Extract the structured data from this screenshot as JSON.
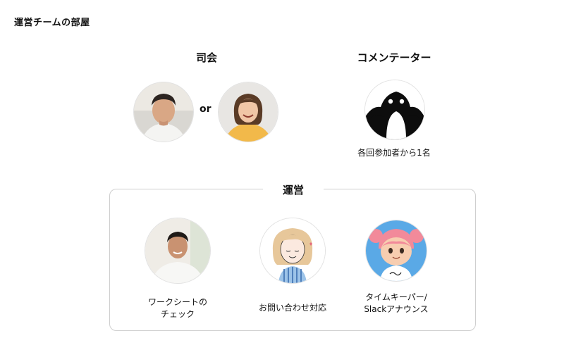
{
  "page": {
    "title": "運営チームの部屋"
  },
  "mc": {
    "heading": "司会",
    "separator": "or"
  },
  "commentator": {
    "heading": "コメンテーター",
    "caption": "各回参加者から1名"
  },
  "operations": {
    "heading": "運営",
    "members": [
      {
        "caption_line1": "ワークシートの",
        "caption_line2": "チェック"
      },
      {
        "caption_line1": "お問い合わせ対応",
        "caption_line2": ""
      },
      {
        "caption_line1": "タイムキーパー/",
        "caption_line2": "Slackアナウンス"
      }
    ]
  },
  "colors": {
    "border": "#cfcfcf",
    "text": "#111111",
    "penguin": "#0d0d0d",
    "villager_hair": "#f28a9a",
    "villager_bg": "#5aa9e6"
  }
}
